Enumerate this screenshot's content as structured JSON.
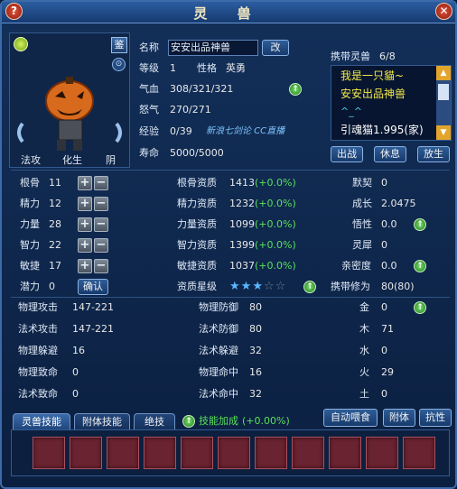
{
  "title": "灵 兽",
  "header_buttons": {
    "help": "?",
    "close": "✕"
  },
  "portrait": {
    "lock_label": "鉴",
    "name_tags": [
      "法攻",
      "化生",
      "阴"
    ]
  },
  "info": {
    "name_label": "名称",
    "name_value": "安安出品神兽",
    "rename_button": "改",
    "level_label": "等级",
    "level_value": "1",
    "personality_label": "性格",
    "personality_value": "英勇",
    "hp_label": "气血",
    "hp_value": "308/321/321",
    "anger_label": "怒气",
    "anger_value": "270/271",
    "exp_label": "经验",
    "exp_value": "0/39",
    "life_label": "寿命",
    "life_value": "5000/5000",
    "watermark": "新浪七剑论 CC直播"
  },
  "carried": {
    "label": "携带灵兽",
    "count": "6/8",
    "list": [
      "我是一只貓~",
      "安安出品神兽",
      "^_^",
      "引魂猫1.995(家)"
    ],
    "buttons": [
      "出战",
      "休息",
      "放生"
    ]
  },
  "base_stats": [
    {
      "label": "根骨",
      "value": "11"
    },
    {
      "label": "精力",
      "value": "12"
    },
    {
      "label": "力量",
      "value": "28"
    },
    {
      "label": "智力",
      "value": "22"
    },
    {
      "label": "敏捷",
      "value": "17"
    }
  ],
  "potential": {
    "label": "潜力",
    "value": "0",
    "confirm": "确认"
  },
  "aptitudes": [
    {
      "label": "根骨资质",
      "value": "1413",
      "bonus": "(+0.0%)"
    },
    {
      "label": "精力资质",
      "value": "1232",
      "bonus": "(+0.0%)"
    },
    {
      "label": "力量资质",
      "value": "1099",
      "bonus": "(+0.0%)"
    },
    {
      "label": "智力资质",
      "value": "1399",
      "bonus": "(+0.0%)"
    },
    {
      "label": "敏捷资质",
      "value": "1037",
      "bonus": "(+0.0%)"
    }
  ],
  "star_rating": {
    "label": "资质星级",
    "filled": 3,
    "total": 5
  },
  "right_stats": [
    {
      "label": "默契",
      "value": "0"
    },
    {
      "label": "成长",
      "value": "2.0475"
    },
    {
      "label": "悟性",
      "value": "0.0"
    },
    {
      "label": "灵犀",
      "value": "0"
    },
    {
      "label": "亲密度",
      "value": "0.0"
    }
  ],
  "carry_cultivation": {
    "label": "携带修为",
    "value": "80(80)"
  },
  "combat": [
    {
      "label": "物理攻击",
      "value": "147-221"
    },
    {
      "label": "法术攻击",
      "value": "147-221"
    },
    {
      "label": "物理躲避",
      "value": "16"
    },
    {
      "label": "物理致命",
      "value": "0"
    },
    {
      "label": "法术致命",
      "value": "0"
    }
  ],
  "combat2": [
    {
      "label": "物理防御",
      "value": "80"
    },
    {
      "label": "法术防御",
      "value": "80"
    },
    {
      "label": "法术躲避",
      "value": "32"
    },
    {
      "label": "物理命中",
      "value": "16"
    },
    {
      "label": "法术命中",
      "value": "32"
    }
  ],
  "elements": [
    {
      "label": "金",
      "value": "0"
    },
    {
      "label": "木",
      "value": "71"
    },
    {
      "label": "水",
      "value": "0"
    },
    {
      "label": "火",
      "value": "29"
    },
    {
      "label": "土",
      "value": "0"
    }
  ],
  "tabs": [
    "灵兽技能",
    "附体技能",
    "绝技"
  ],
  "skill_bonus": {
    "label": "技能加成",
    "value": "(+0.00%)"
  },
  "bottom_buttons": [
    "自动喂食",
    "附体",
    "抗性"
  ],
  "skill_slot_count": 11
}
